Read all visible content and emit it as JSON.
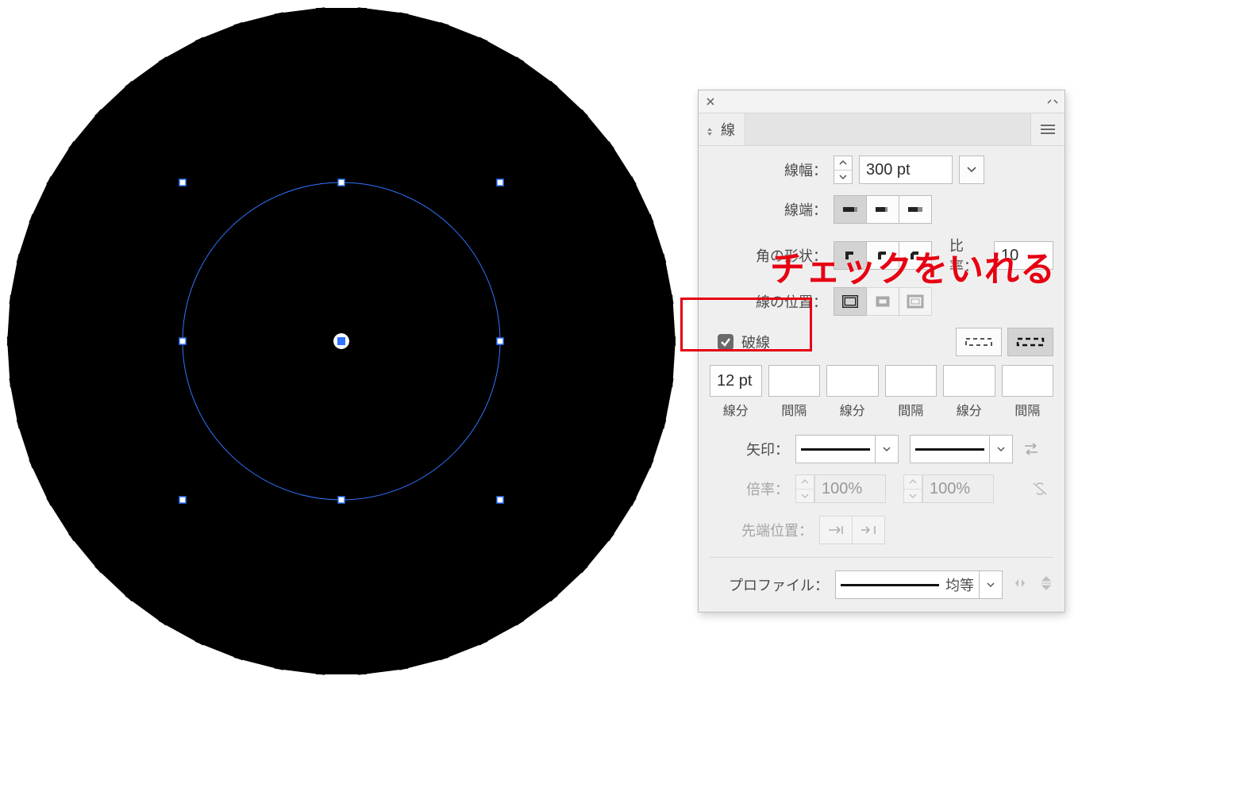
{
  "panel": {
    "tab_title": "線",
    "stroke_width": {
      "label": "線幅：",
      "value": "300 pt"
    },
    "cap": {
      "label": "線端："
    },
    "corner": {
      "label": "角の形状：",
      "ratio_label": "比率：",
      "ratio_value": "10"
    },
    "align": {
      "label": "線の位置："
    },
    "dashed": {
      "checkbox_label": "破線",
      "checked": true,
      "values": [
        "12 pt",
        "",
        "",
        "",
        "",
        ""
      ],
      "col_labels": [
        "線分",
        "間隔",
        "線分",
        "間隔",
        "線分",
        "間隔"
      ]
    },
    "arrows": {
      "label": "矢印："
    },
    "scale": {
      "label": "倍率：",
      "left": "100%",
      "right": "100%"
    },
    "tip": {
      "label": "先端位置："
    },
    "profile": {
      "label": "プロファイル：",
      "value": "均等"
    }
  },
  "annotation": {
    "text": "チェックをいれる"
  },
  "chart_data": {
    "type": "other",
    "description": "Radial sunburst of 50 black spokes produced by a 300pt dashed stroke (dash 12pt) on a selected circle in Illustrator; selection bounding circle shown in blue with 8 handles."
  }
}
